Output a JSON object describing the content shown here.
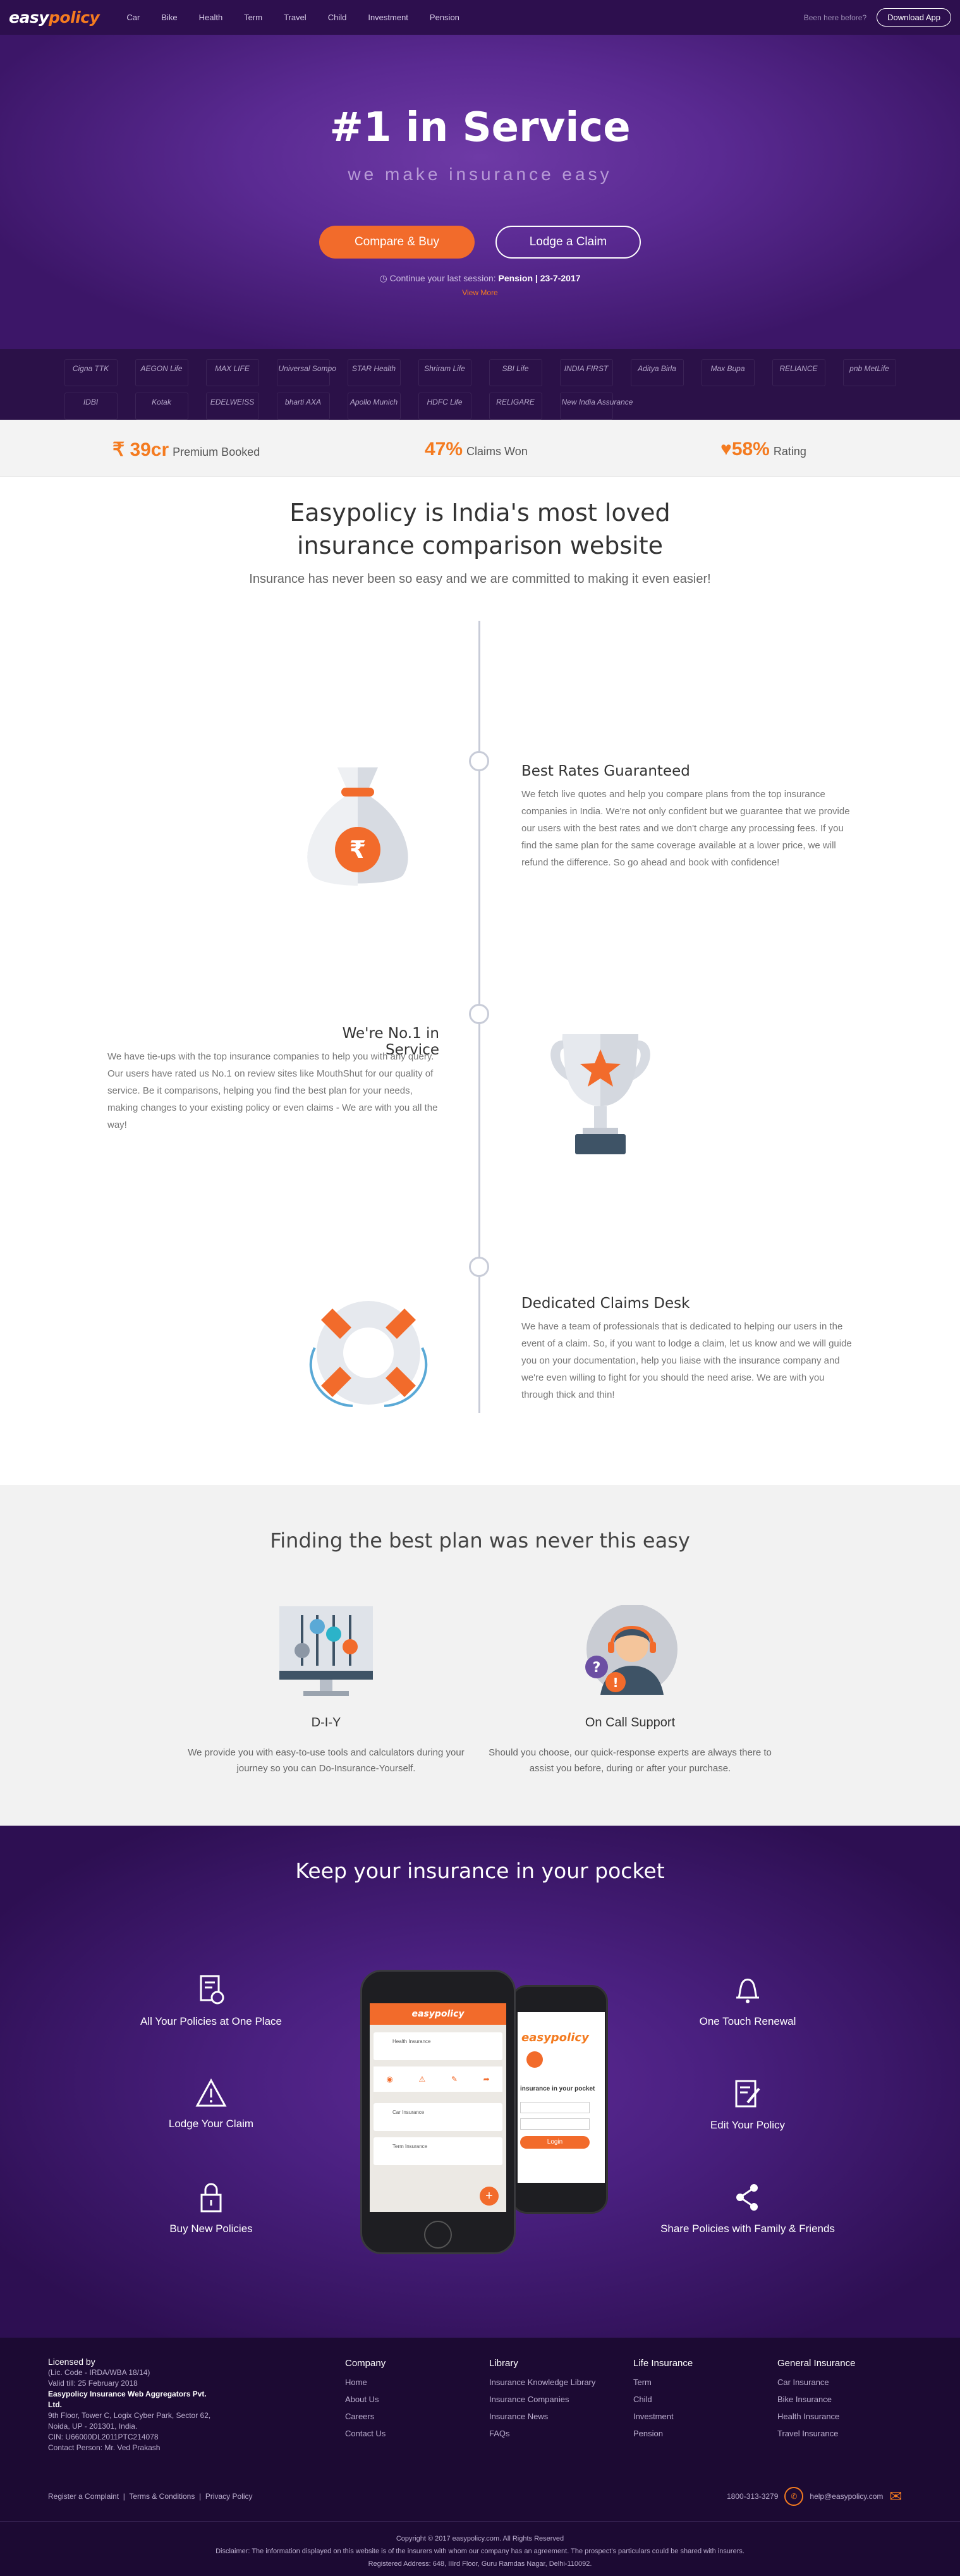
{
  "brand": {
    "logo_easy": "easy",
    "logo_policy": "policy",
    "accent": "#f47b20",
    "purple": "#4a2080"
  },
  "nav": {
    "links": [
      "Car",
      "Bike",
      "Health",
      "Term",
      "Travel",
      "Child",
      "Investment",
      "Pension"
    ],
    "been_here": "Been here before?",
    "download": "Download App"
  },
  "hero": {
    "title": "#1 in Service",
    "tagline": "we make insurance easy",
    "compare": "Compare & Buy",
    "claim": "Lodge a Claim",
    "continue_prefix": "Continue your last session:",
    "continue_value": "Pension | 23-7-2017",
    "view_more": "View More"
  },
  "partners": [
    "Cigna TTK",
    "AEGON Life",
    "MAX LIFE",
    "Universal Sompo",
    "STAR Health",
    "Shriram Life",
    "SBI Life",
    "INDIA FIRST",
    "Aditya Birla",
    "Max Bupa",
    "RELIANCE",
    "pnb MetLife",
    "IDBI",
    "Kotak",
    "EDELWEISS",
    "bharti AXA",
    "Apollo Munich",
    "HDFC Life",
    "RELIGARE",
    "New India Assurance"
  ],
  "stats": [
    {
      "value": "39cr",
      "label": "Premium Booked"
    },
    {
      "value": "47%",
      "label": "Claims Won"
    },
    {
      "value": "58%",
      "label": "Rating"
    }
  ],
  "loved": {
    "title_l1": "Easypolicy is India's most loved",
    "title_l2": "insurance comparison website",
    "subtitle": "Insurance has never been so easy and we are committed to making it even easier!"
  },
  "features": [
    {
      "title": "Best Rates Guaranteed",
      "text": "We fetch live quotes and help you compare plans from the top insurance companies in India. We're not only confident but we guarantee that we provide our users with the best rates and we don't charge any processing fees. If you find the same plan for the same coverage available at a lower price, we will refund the difference. So go ahead and book with confidence!"
    },
    {
      "title": "We're No.1 in Service",
      "text": "We have tie-ups with the top insurance companies to help you with any query. Our users have rated us No.1 on review sites like MouthShut for our quality of service. Be it comparisons, helping you find the best plan for your needs, making changes to your existing policy or even claims - We are with you all the way!"
    },
    {
      "title": "Dedicated Claims Desk",
      "text": "We have a team of professionals that is dedicated to helping our users in the event of a claim. So, if you want to lodge a claim, let us know and we will guide you on your documentation, help you liaise with the insurance company and we're even willing to fight for you should the need arise. We are with you through thick and thin!"
    }
  ],
  "easy": {
    "title": "Finding the best plan was never this easy",
    "diy_title": "D-I-Y",
    "diy_text": "We provide you with easy-to-use tools and calculators during your journey so you can Do-Insurance-Yourself.",
    "call_title": "On Call Support",
    "call_text": "Should you choose, our quick-response experts are always there to assist you before, during or after your purchase."
  },
  "pocket": {
    "title": "Keep your insurance in your pocket",
    "left": [
      "All Your Policies at One Place",
      "Lodge Your Claim",
      "Buy New Policies"
    ],
    "right": [
      "One Touch Renewal",
      "Edit Your Policy",
      "Share Policies with Family & Friends"
    ],
    "phone": {
      "brand": "easypolicy",
      "row1": "Health Insurance",
      "row2": "Car Insurance",
      "row3": "Term Insurance",
      "login_title": "insurance in your pocket",
      "login_btn": "Login"
    }
  },
  "footer": {
    "licensed": "Licensed by",
    "lic_code": "(Lic. Code - IRDA/WBA 18/14)",
    "valid": "Valid till: 25 February 2018",
    "company_name": "Easypolicy Insurance Web Aggregators Pvt. Ltd.",
    "address": "9th Floor, Tower C, Logix Cyber Park, Sector 62, Noida, UP - 201301, India.",
    "cin": "CIN: U66000DL2011PTC214078",
    "contact": "Contact Person: Mr. Ved Prakash",
    "cols": [
      {
        "title": "Company",
        "items": [
          "Home",
          "About Us",
          "Careers",
          "Contact Us"
        ]
      },
      {
        "title": "Library",
        "items": [
          "Insurance Knowledge Library",
          "Insurance Companies",
          "Insurance News",
          "FAQs"
        ]
      },
      {
        "title": "Life Insurance",
        "items": [
          "Term",
          "Child",
          "Investment",
          "Pension"
        ]
      },
      {
        "title": "General Insurance",
        "items": [
          "Car Insurance",
          "Bike Insurance",
          "Health Insurance",
          "Travel Insurance"
        ]
      }
    ],
    "legal": [
      "Register a Complaint",
      "Terms & Conditions",
      "Privacy Policy"
    ],
    "phone": "1800-313-3279",
    "email": "help@easypolicy.com",
    "copyright": "Copyright © 2017 easypolicy.com. All Rights Reserved",
    "disclaimer": "Disclaimer: The information displayed on this website is of the insurers with whom our company has an agreement. The prospect's particulars could be shared with insurers.",
    "reg": "Registered Address: 648, IIIrd Floor, Guru Ramdas Nagar, Delhi-110092."
  }
}
